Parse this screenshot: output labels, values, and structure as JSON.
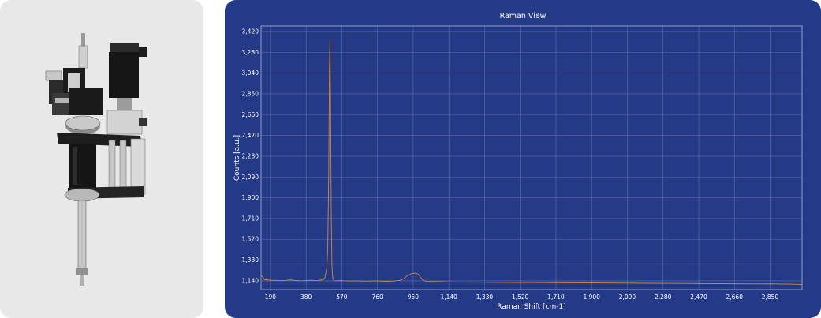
{
  "product": {
    "image_name": "raman-probe-assembly"
  },
  "colors": {
    "panel": "#243a86",
    "grid": "#5d6fb0",
    "plot_frame": "#8e9ccc",
    "series": "#d4883b"
  },
  "chart_data": {
    "type": "line",
    "title": "Raman View",
    "xlabel": "Raman Shift [cm-1]",
    "ylabel": "Counts [a.u.]",
    "xlim": [
      140,
      3020
    ],
    "ylim": [
      1060,
      3470
    ],
    "xticks": [
      190,
      380,
      570,
      760,
      950,
      1140,
      1330,
      1520,
      1710,
      1900,
      2090,
      2280,
      2470,
      2660,
      2850
    ],
    "xtick_labels": [
      "190",
      "380",
      "570",
      "760",
      "950",
      "1,140",
      "1,330",
      "1,520",
      "1,710",
      "1,900",
      "2,090",
      "2,280",
      "2,470",
      "2,660",
      "2,850"
    ],
    "yticks": [
      1140,
      1330,
      1520,
      1710,
      1900,
      2090,
      2280,
      2470,
      2660,
      2850,
      3040,
      3230,
      3420
    ],
    "ytick_labels": [
      "1,140",
      "1,330",
      "1,520",
      "1,710",
      "1,900",
      "2,090",
      "2,280",
      "2,470",
      "2,660",
      "2,850",
      "3,040",
      "3,230",
      "3,420"
    ],
    "grid": true,
    "series": [
      {
        "x": [
          140,
          160,
          200,
          250,
          300,
          350,
          400,
          440,
          470,
          480,
          490,
          495,
          500,
          504,
          507,
          510,
          514,
          518,
          522,
          530,
          560,
          600,
          650,
          700,
          750,
          800,
          850,
          880,
          900,
          920,
          940,
          960,
          970,
          980,
          990,
          1000,
          1010,
          1030,
          1060,
          1100,
          1150,
          1200,
          1300,
          1400,
          1500,
          1600,
          1700,
          1800,
          1900,
          2000,
          2100,
          2200,
          2300,
          2400,
          2500,
          2600,
          2700,
          2800,
          2850,
          2900,
          2950,
          3000,
          3020
        ],
        "y": [
          1195,
          1150,
          1145,
          1142,
          1148,
          1140,
          1145,
          1142,
          1150,
          1170,
          1260,
          1450,
          2100,
          3080,
          3350,
          2800,
          1700,
          1260,
          1160,
          1140,
          1142,
          1138,
          1140,
          1137,
          1140,
          1136,
          1138,
          1145,
          1160,
          1190,
          1205,
          1212,
          1208,
          1195,
          1170,
          1150,
          1140,
          1135,
          1133,
          1132,
          1130,
          1128,
          1127,
          1126,
          1125,
          1124,
          1123,
          1122,
          1121,
          1120,
          1119,
          1118,
          1117,
          1116,
          1115,
          1114,
          1113,
          1112,
          1113,
          1111,
          1110,
          1108,
          1107
        ]
      }
    ]
  }
}
